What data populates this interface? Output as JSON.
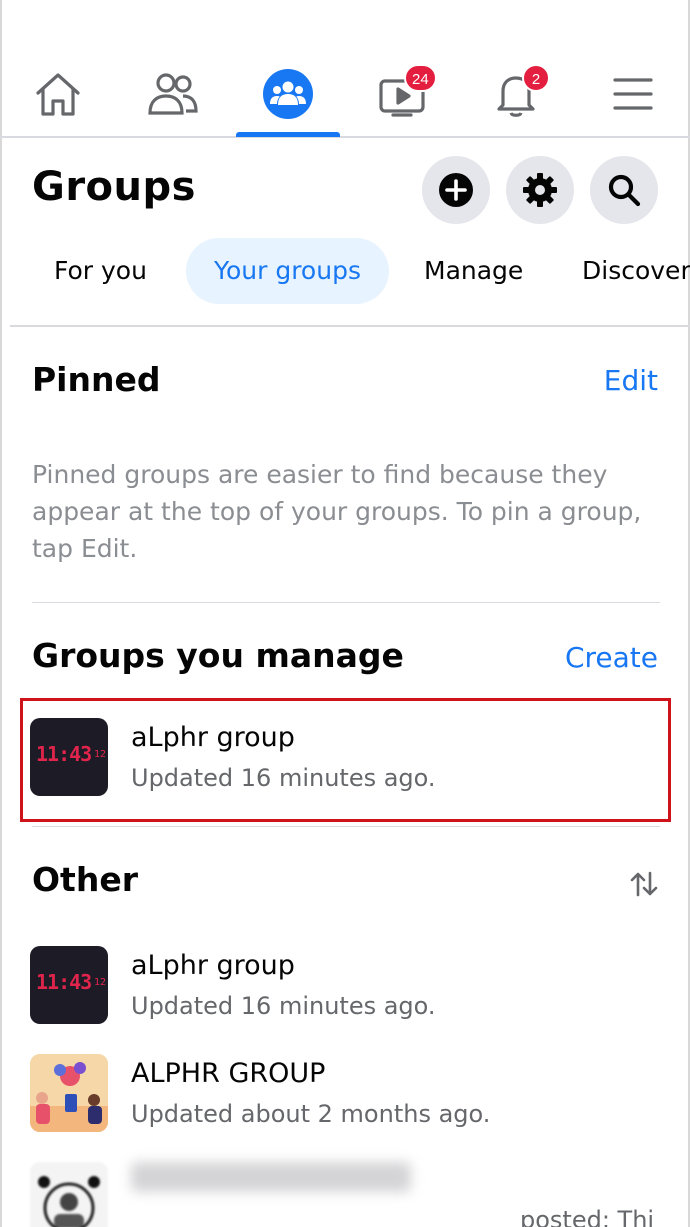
{
  "nav": {
    "watch_badge": "24",
    "notifications_badge": "2",
    "accent_color": "#1877f2",
    "badge_color": "#e41e3f",
    "icons": [
      "home-icon",
      "friends-icon",
      "groups-icon",
      "watch-icon",
      "bell-icon",
      "menu-icon"
    ]
  },
  "header": {
    "title": "Groups",
    "actions": [
      "plus-icon",
      "gear-icon",
      "search-icon"
    ]
  },
  "tabs": [
    {
      "label": "For you",
      "active": false
    },
    {
      "label": "Your groups",
      "active": true
    },
    {
      "label": "Manage",
      "active": false
    },
    {
      "label": "Discover",
      "active": false
    }
  ],
  "pinned": {
    "title": "Pinned",
    "action": "Edit",
    "description": "Pinned groups are easier to find because they appear at the top of your groups. To pin a group, tap Edit."
  },
  "manage": {
    "title": "Groups you manage",
    "action": "Create",
    "items": [
      {
        "name": "aLphr group",
        "meta": "Updated 16 minutes ago.",
        "thumb_clock": "11:43",
        "thumb_sec": "12",
        "highlighted": true
      }
    ]
  },
  "other": {
    "title": "Other",
    "items": [
      {
        "name": "aLphr group",
        "meta": "Updated 16 minutes ago.",
        "thumb_clock": "11:43",
        "thumb_sec": "12"
      },
      {
        "name": "ALPHR GROUP",
        "meta": "Updated about 2 months ago."
      },
      {
        "name": "",
        "meta": "posted: Thi"
      }
    ]
  }
}
